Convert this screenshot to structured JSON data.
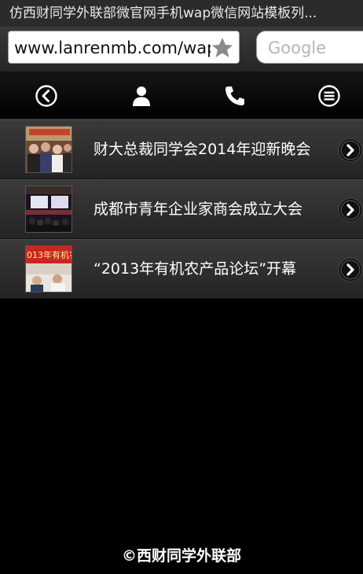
{
  "browser": {
    "title": "仿西财同学外联部微官网手机wap微信网站模板列...",
    "url": "www.lanrenmb.com/wap",
    "search_placeholder": "Google"
  },
  "nav": {
    "icons": [
      "back-circle-icon",
      "user-icon",
      "phone-icon",
      "menu-icon"
    ]
  },
  "news": [
    {
      "title": "财大总裁同学会2014年迎新晚会",
      "thumb": "party-photo"
    },
    {
      "title": "成都市青年企业家商会成立大会",
      "thumb": "conference-photo"
    },
    {
      "title": "“2013年有机农产品论坛”开幕",
      "thumb": "forum-photo",
      "thumb_text": "013年有机农"
    }
  ],
  "footer": {
    "text": "©西财同学外联部"
  }
}
